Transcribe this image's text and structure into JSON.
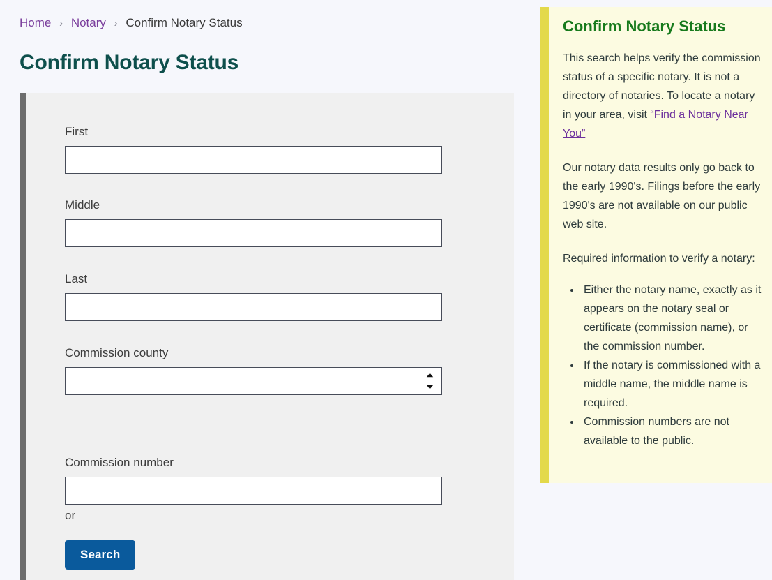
{
  "breadcrumb": {
    "items": [
      {
        "label": "Home",
        "type": "link"
      },
      {
        "label": "Notary",
        "type": "link"
      },
      {
        "label": "Confirm Notary Status",
        "type": "current"
      }
    ],
    "separator": "›"
  },
  "page": {
    "title": "Confirm Notary Status"
  },
  "form": {
    "fields": [
      {
        "label": "First",
        "value": "",
        "type": "text",
        "name": "first-name"
      },
      {
        "label": "Middle",
        "value": "",
        "type": "text",
        "name": "middle-name"
      },
      {
        "label": "Last",
        "value": "",
        "type": "text",
        "name": "last-name"
      }
    ],
    "county": {
      "label": "Commission county",
      "value": "",
      "options": [
        ""
      ]
    },
    "or_text": "or",
    "commission_number": {
      "label": "Commission number",
      "value": ""
    },
    "submit_label": "Search"
  },
  "sidebar": {
    "title": "Confirm Notary Status",
    "paragraph_1_before": "This search helps verify the commission status of a specific notary. It is not a directory of notaries. To locate a notary in your area, visit ",
    "paragraph_1_link": "“Find a Notary Near You”",
    "paragraph_2": "Our notary data results only go back to the early 1990's. Filings before the early 1990's are not available on our public web site.",
    "paragraph_3": "Required information to verify a notary:",
    "bullets": [
      "Either the notary name, exactly as it appears on the notary seal or certificate (commission name), or the commission number.",
      "If the notary is commissioned with a middle name, the middle name is required.",
      "Commission numbers are not available to the public."
    ]
  },
  "colors": {
    "page_background": "#f6f7fc",
    "panel_background": "#f0f0f0",
    "panel_accent_bar": "#6d6d6d",
    "heading_teal": "#0e4f4c",
    "breadcrumb_link_purple": "#7b3f9d",
    "button_blue": "#0a5a9c",
    "callout_background": "#fcfbe1",
    "callout_accent_bar": "#e3d94a",
    "callout_heading_green": "#177a1c",
    "callout_link_purple": "#6c2f9c",
    "input_border": "#474c59"
  }
}
